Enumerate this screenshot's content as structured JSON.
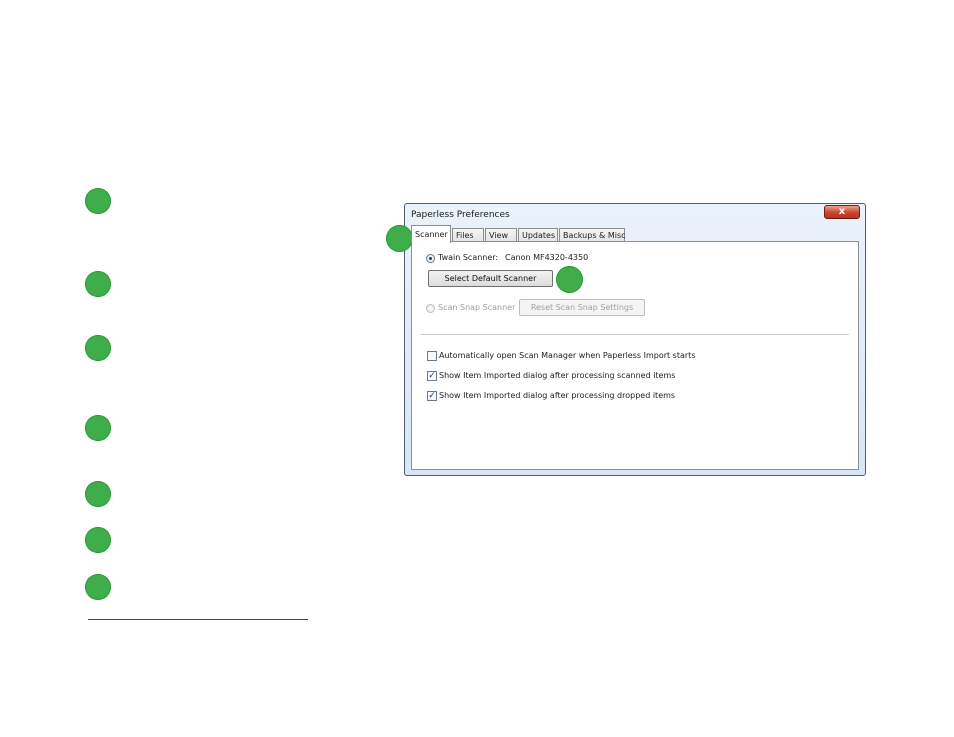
{
  "window": {
    "title": "Paperless Preferences",
    "close_glyph": "x"
  },
  "tabs": [
    {
      "label": "Scanner",
      "active": true
    },
    {
      "label": "Files",
      "active": false
    },
    {
      "label": "View",
      "active": false
    },
    {
      "label": "Updates",
      "active": false
    },
    {
      "label": "Backups & Misc",
      "active": false
    }
  ],
  "scanner": {
    "twain_label": "Twain Scanner:",
    "twain_value": "Canon MF4320-4350",
    "select_default_button": "Select Default Scanner",
    "scansnap_label": "Scan Snap Scanner",
    "reset_scansnap_button": "Reset Scan Snap Settings"
  },
  "options": [
    {
      "label": "Automatically open Scan Manager when Paperless Import starts",
      "checked": false
    },
    {
      "label": "Show Item Imported dialog after processing scanned items",
      "checked": true
    },
    {
      "label": "Show Item Imported dialog after processing dropped items",
      "checked": true
    }
  ],
  "colors": {
    "callout_marker": "#3fae4a",
    "link_rule": "#2a3fd8"
  },
  "icons": {
    "check": "✓"
  }
}
